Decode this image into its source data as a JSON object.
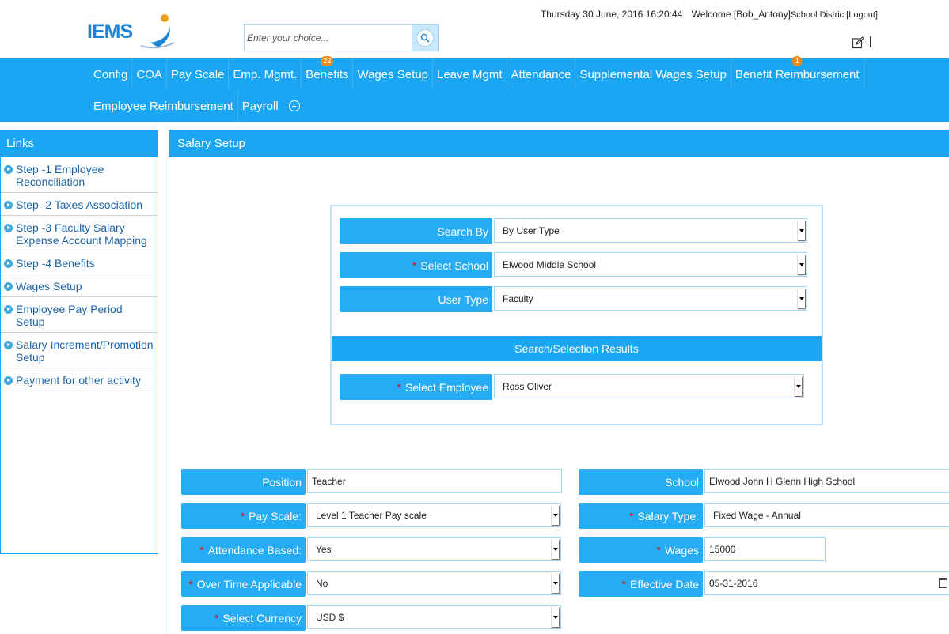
{
  "header": {
    "logo_text": "IEMS",
    "datetime": "Thursday 30 June, 2016 16:20:44",
    "welcome": "Welcome [Bob_Antony]",
    "district": "School District",
    "logout": "[Logout]",
    "search_placeholder": "Enter your choice..."
  },
  "nav": {
    "row1": [
      {
        "label": "Config"
      },
      {
        "label": "COA"
      },
      {
        "label": "Pay Scale"
      },
      {
        "label": "Emp. Mgmt."
      },
      {
        "label": "Benefits",
        "badge": "22"
      },
      {
        "label": "Wages Setup"
      },
      {
        "label": "Leave Mgmt"
      },
      {
        "label": "Attendance"
      },
      {
        "label": "Supplemental Wages Setup"
      },
      {
        "label": "Benefit Reimbursement",
        "badge": "1"
      }
    ],
    "row2": [
      {
        "label": "Employee Reimbursement"
      },
      {
        "label": "Payroll"
      }
    ]
  },
  "sidebar": {
    "title": "Links",
    "items": [
      {
        "label": "Step -1 Employee Reconciliation"
      },
      {
        "label": "Step -2 Taxes Association"
      },
      {
        "label": "Step -3 Faculty Salary Expense Account Mapping"
      },
      {
        "label": "Step -4 Benefits"
      },
      {
        "label": "Wages Setup"
      },
      {
        "label": "Employee Pay Period Setup"
      },
      {
        "label": "Salary Increment/Promotion Setup"
      },
      {
        "label": "Payment for other activity"
      }
    ]
  },
  "main": {
    "title": "Salary Setup",
    "search": {
      "search_by_label": "Search By",
      "search_by_value": "By User Type",
      "school_label": "Select School",
      "school_value": "Elwood Middle School",
      "user_type_label": "User Type",
      "user_type_value": "Faculty",
      "results_title": "Search/Selection Results",
      "employee_label": "Select Employee",
      "employee_value": "Ross Oliver"
    },
    "form": {
      "position_label": "Position",
      "position_value": "Teacher",
      "school_label": "School",
      "school_value": "Elwood John H Glenn High School",
      "pay_scale_label": "Pay Scale:",
      "pay_scale_value": "Level 1 Teacher Pay scale",
      "salary_type_label": "Salary Type:",
      "salary_type_value": "Fixed Wage - Annual",
      "attendance_label": "Attendance Based:",
      "attendance_value": "Yes",
      "wages_label": "Wages",
      "wages_value": "15000",
      "overtime_label": "Over Time Applicable",
      "overtime_value": "No",
      "effective_date_label": "Effective Date",
      "effective_date_value": "05-31-2016",
      "currency_label": "Select Currency",
      "currency_value": "USD $"
    },
    "required_marker": "*"
  },
  "colors": {
    "primary": "#1aa6f2",
    "label_bg": "#26acf4",
    "link": "#1b63a6",
    "badge": "#f08a16",
    "required": "#d81313"
  }
}
